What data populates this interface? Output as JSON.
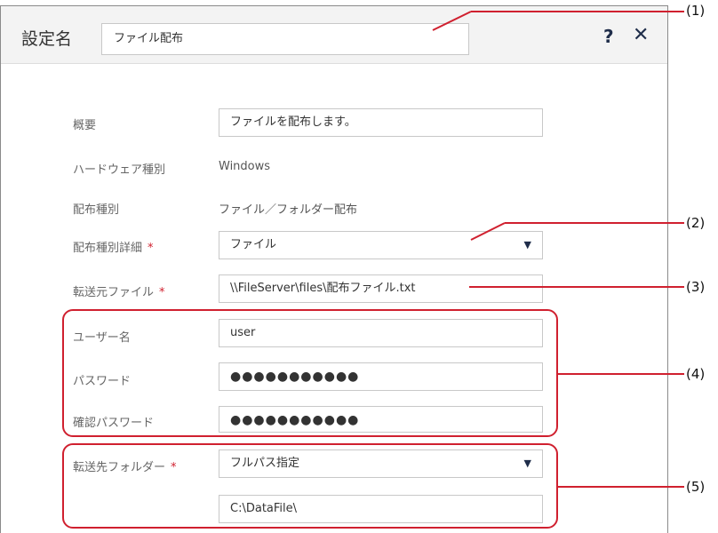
{
  "dialog": {
    "title": "設定名",
    "name_value": "ファイル配布",
    "help_glyph": "?",
    "close_glyph": "✕"
  },
  "form": {
    "summary_label": "概要",
    "summary_value": "ファイルを配布します。",
    "hardware_label": "ハードウェア種別",
    "hardware_value": "Windows",
    "dist_type_label": "配布種別",
    "dist_type_value": "ファイル／フォルダー配布",
    "dist_detail_label": "配布種別詳細",
    "dist_detail_value": "ファイル",
    "source_label": "転送元ファイル",
    "source_value": "\\\\FileServer\\files\\配布ファイル.txt",
    "user_label": "ユーザー名",
    "user_value": "user",
    "password_label": "パスワード",
    "password_value": "●●●●●●●●●●●",
    "confirm_label": "確認パスワード",
    "confirm_value": "●●●●●●●●●●●",
    "dest_label": "転送先フォルダー",
    "dest_mode_value": "フルパス指定",
    "dest_path_value": "C:\\DataFile\\",
    "required_mark": "*",
    "dropdown_glyph": "▼"
  },
  "callouts": [
    "(1)",
    "(2)",
    "(3)",
    "(4)",
    "(5)"
  ],
  "colors": {
    "callout": "#d0202f",
    "required": "#d0202f",
    "icon": "#1f2d4a"
  }
}
